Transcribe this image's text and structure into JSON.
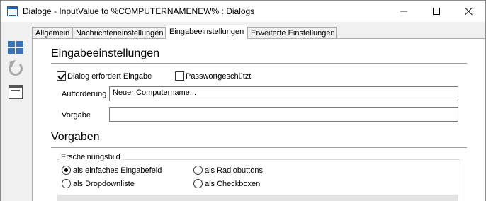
{
  "window": {
    "title": "Dialoge - InputValue to %COMPUTERNAMENEW% : Dialogs"
  },
  "toolbar": {
    "icons": [
      "grid-icon",
      "refresh-icon",
      "form-icon"
    ]
  },
  "tabs": [
    {
      "label": "Allgemein",
      "active": false
    },
    {
      "label": "Nachrichteneinstellungen",
      "active": false
    },
    {
      "label": "Eingabeeinstellungen",
      "active": true
    },
    {
      "label": "Erweiterte Einstellungen",
      "active": false
    }
  ],
  "input_settings": {
    "heading": "Eingabeeinstellungen",
    "require_input_label": "Dialog erfordert Eingabe",
    "require_input_checked": true,
    "password_label": "Passwortgeschützt",
    "password_checked": false,
    "prompt_label": "Aufforderung",
    "prompt_value": "Neuer Computername...",
    "default_label": "Vorgabe",
    "default_value": ""
  },
  "defaults": {
    "heading": "Vorgaben",
    "appearance_title": "Erscheinungsbild",
    "options": [
      {
        "label": "als einfaches Eingabefeld",
        "selected": true
      },
      {
        "label": "als Radiobuttons",
        "selected": false
      },
      {
        "label": "als Dropdownliste",
        "selected": false
      },
      {
        "label": "als Checkboxen",
        "selected": false
      }
    ]
  },
  "colors": {
    "accent": "#3b73b9",
    "window_bg": "#f0f0f0",
    "panel_bg": "#ffffff"
  }
}
